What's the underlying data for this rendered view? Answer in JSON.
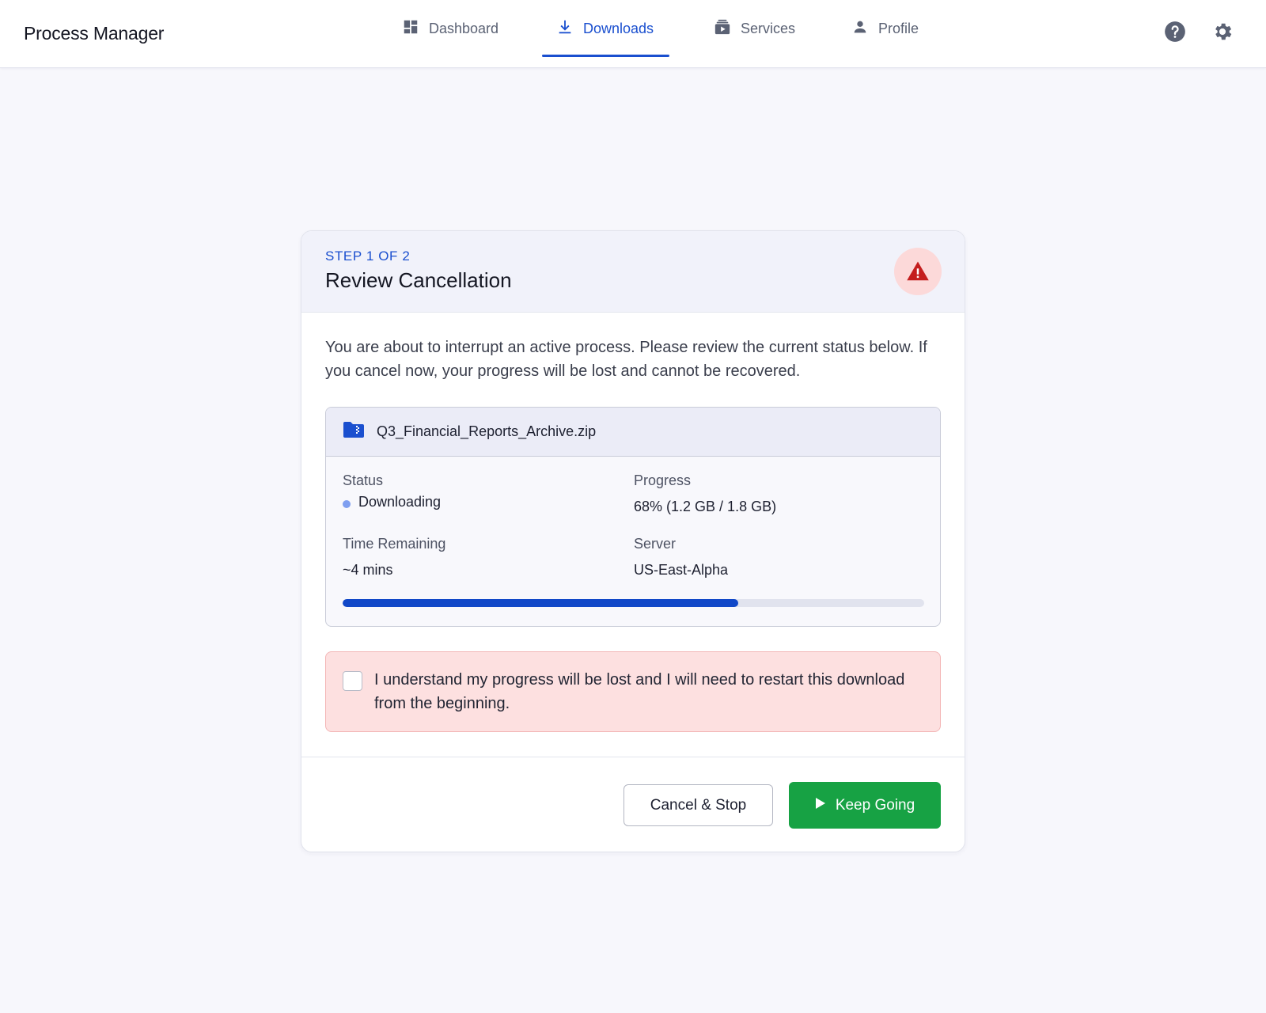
{
  "app": {
    "title": "Process Manager"
  },
  "nav": {
    "tabs": [
      {
        "label": "Dashboard",
        "icon": "dashboard-icon",
        "active": false
      },
      {
        "label": "Downloads",
        "icon": "download-icon",
        "active": true
      },
      {
        "label": "Services",
        "icon": "services-icon",
        "active": false
      },
      {
        "label": "Profile",
        "icon": "person-icon",
        "active": false
      }
    ],
    "actions": [
      {
        "icon": "help-icon"
      },
      {
        "icon": "gear-icon"
      }
    ]
  },
  "dialog": {
    "step": "STEP 1 OF 2",
    "title": "Review Cancellation",
    "badge_icon": "warning-icon",
    "intro": "You are about to interrupt an active process. Please review the current status below. If you cancel now, your progress will be lost and cannot be recovered.",
    "file": {
      "icon": "zip-folder-icon",
      "name": "Q3_Financial_Reports_Archive.zip",
      "status_label": "Status",
      "status_value": "Downloading",
      "progress_label": "Progress",
      "progress_value": "68% (1.2 GB / 1.8 GB)",
      "progress_fraction": 0.68,
      "time_label": "Time Remaining",
      "time_value": "~4 mins",
      "server_label": "Server",
      "server_value": "US-East-Alpha"
    },
    "acknowledge": {
      "checked": false,
      "text": "I understand my progress will be lost and I will need to restart this download from the beginning."
    },
    "buttons": {
      "cancel": "Cancel & Stop",
      "keep": "Keep Going",
      "keep_icon": "play-icon"
    }
  },
  "colors": {
    "accent": "#1a4fcf",
    "progress": "#1148c8",
    "success": "#17a244",
    "danger_bg": "#fde0e0",
    "warning": "#c41e1e"
  }
}
